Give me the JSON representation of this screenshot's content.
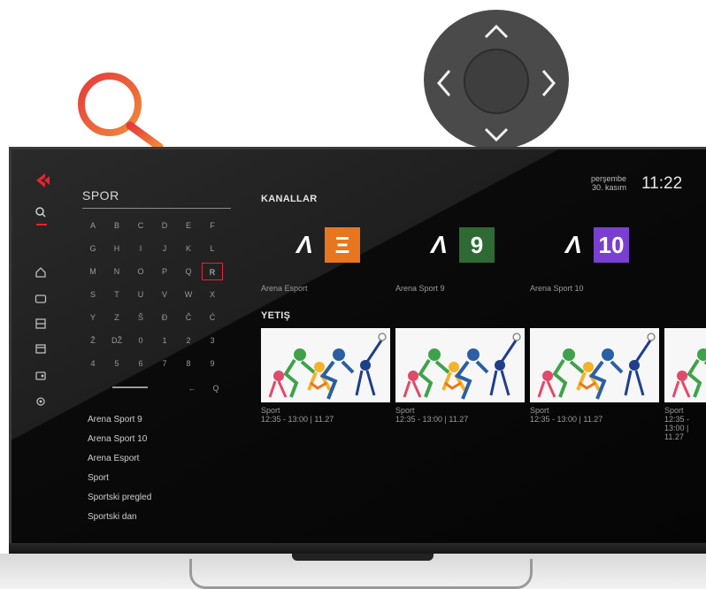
{
  "keyboard": {
    "query": "SPOR",
    "rows": [
      [
        "A",
        "B",
        "C",
        "D",
        "E",
        "F"
      ],
      [
        "G",
        "H",
        "I",
        "J",
        "K",
        "L"
      ],
      [
        "M",
        "N",
        "O",
        "P",
        "Q",
        "R"
      ],
      [
        "S",
        "T",
        "U",
        "V",
        "W",
        "X"
      ],
      [
        "Y",
        "Z",
        "Š",
        "Đ",
        "Č",
        "Ć"
      ],
      [
        "Ž",
        "DŽ",
        "0",
        "1",
        "2",
        "3"
      ],
      [
        "4",
        "5",
        "6",
        "7",
        "8",
        "9"
      ]
    ],
    "selected_key": "R",
    "backspace": "←",
    "search": "Q"
  },
  "suggestions": [
    "Arena Sport 9",
    "Arena Sport 10",
    "Arena Esport",
    "Sport",
    "Sportski pregled",
    "Sportski dan"
  ],
  "header": {
    "day": "perşembe",
    "date": "30. kasım",
    "time": "11:22"
  },
  "channels_section": {
    "title": "KANALLAR",
    "items": [
      {
        "mark": "Ʌ",
        "badge": "Ξ",
        "badge_color": "#e8761e",
        "name": "Arena Esport"
      },
      {
        "mark": "Ʌ",
        "badge": "9",
        "badge_color": "#2f6a34",
        "name": "Arena Sport 9"
      },
      {
        "mark": "Ʌ",
        "badge": "10",
        "badge_color": "#7a3fd0",
        "name": "Arena Sport 10"
      }
    ]
  },
  "catchup_section": {
    "title": "YETIŞ",
    "items": [
      {
        "genre": "Sport",
        "time": "12:35 - 13:00 | 11.27"
      },
      {
        "genre": "Sport",
        "time": "12:35 - 13:00 | 11.27"
      },
      {
        "genre": "Sport",
        "time": "12:35 - 13:00 | 11.27"
      },
      {
        "genre": "Sport",
        "time": "12:35 - 13:00 | 11.27"
      }
    ]
  },
  "sidebar": {
    "logo_color": "#e5252f",
    "items": [
      "search-icon",
      "home-icon",
      "tv-icon",
      "film-icon",
      "guide-icon",
      "radio-icon",
      "settings-icon"
    ]
  },
  "accent": "#e5252f"
}
